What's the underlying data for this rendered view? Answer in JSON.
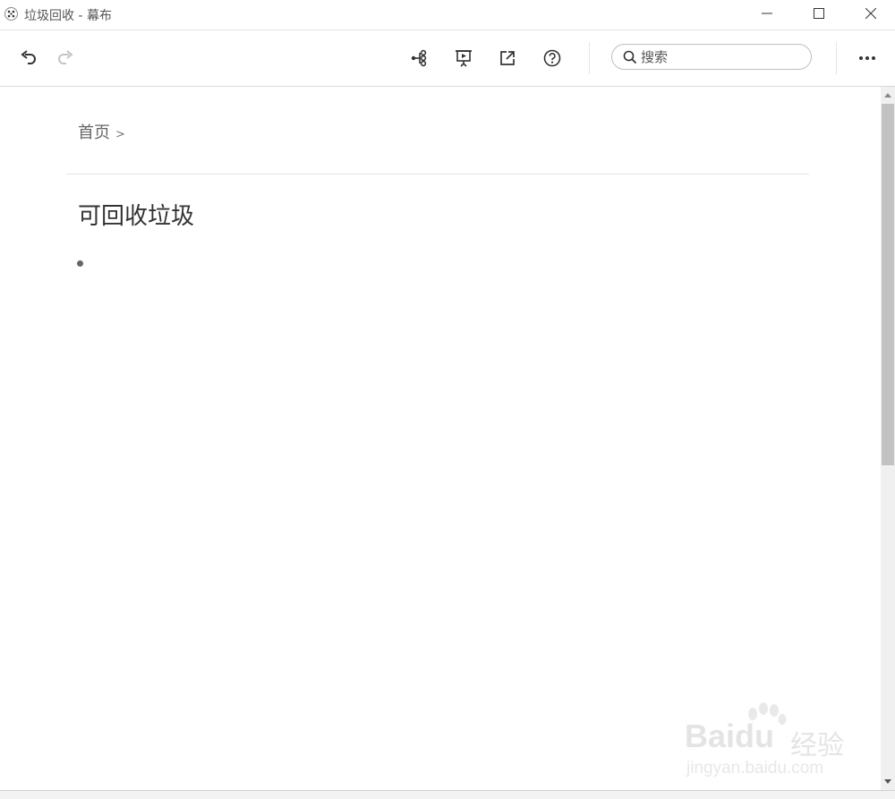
{
  "window": {
    "title": "垃圾回收 - 幕布"
  },
  "toolbar": {
    "icons": [
      "undo-icon",
      "redo-icon",
      "mindmap-icon",
      "presentation-icon",
      "share-icon",
      "help-icon",
      "more-icon"
    ],
    "search_placeholder": "搜索"
  },
  "breadcrumb": {
    "home": "首页",
    "separator": ">"
  },
  "document": {
    "title": "可回收垃圾",
    "items": [
      ""
    ]
  },
  "watermark": {
    "brand": "Baidu",
    "suffix": "经验",
    "url": "jingyan.baidu.com"
  },
  "colors": {
    "text": "#333333",
    "muted": "#666666",
    "divider": "#e6e6e6",
    "scrollbar_thumb": "#c2c2c2"
  }
}
